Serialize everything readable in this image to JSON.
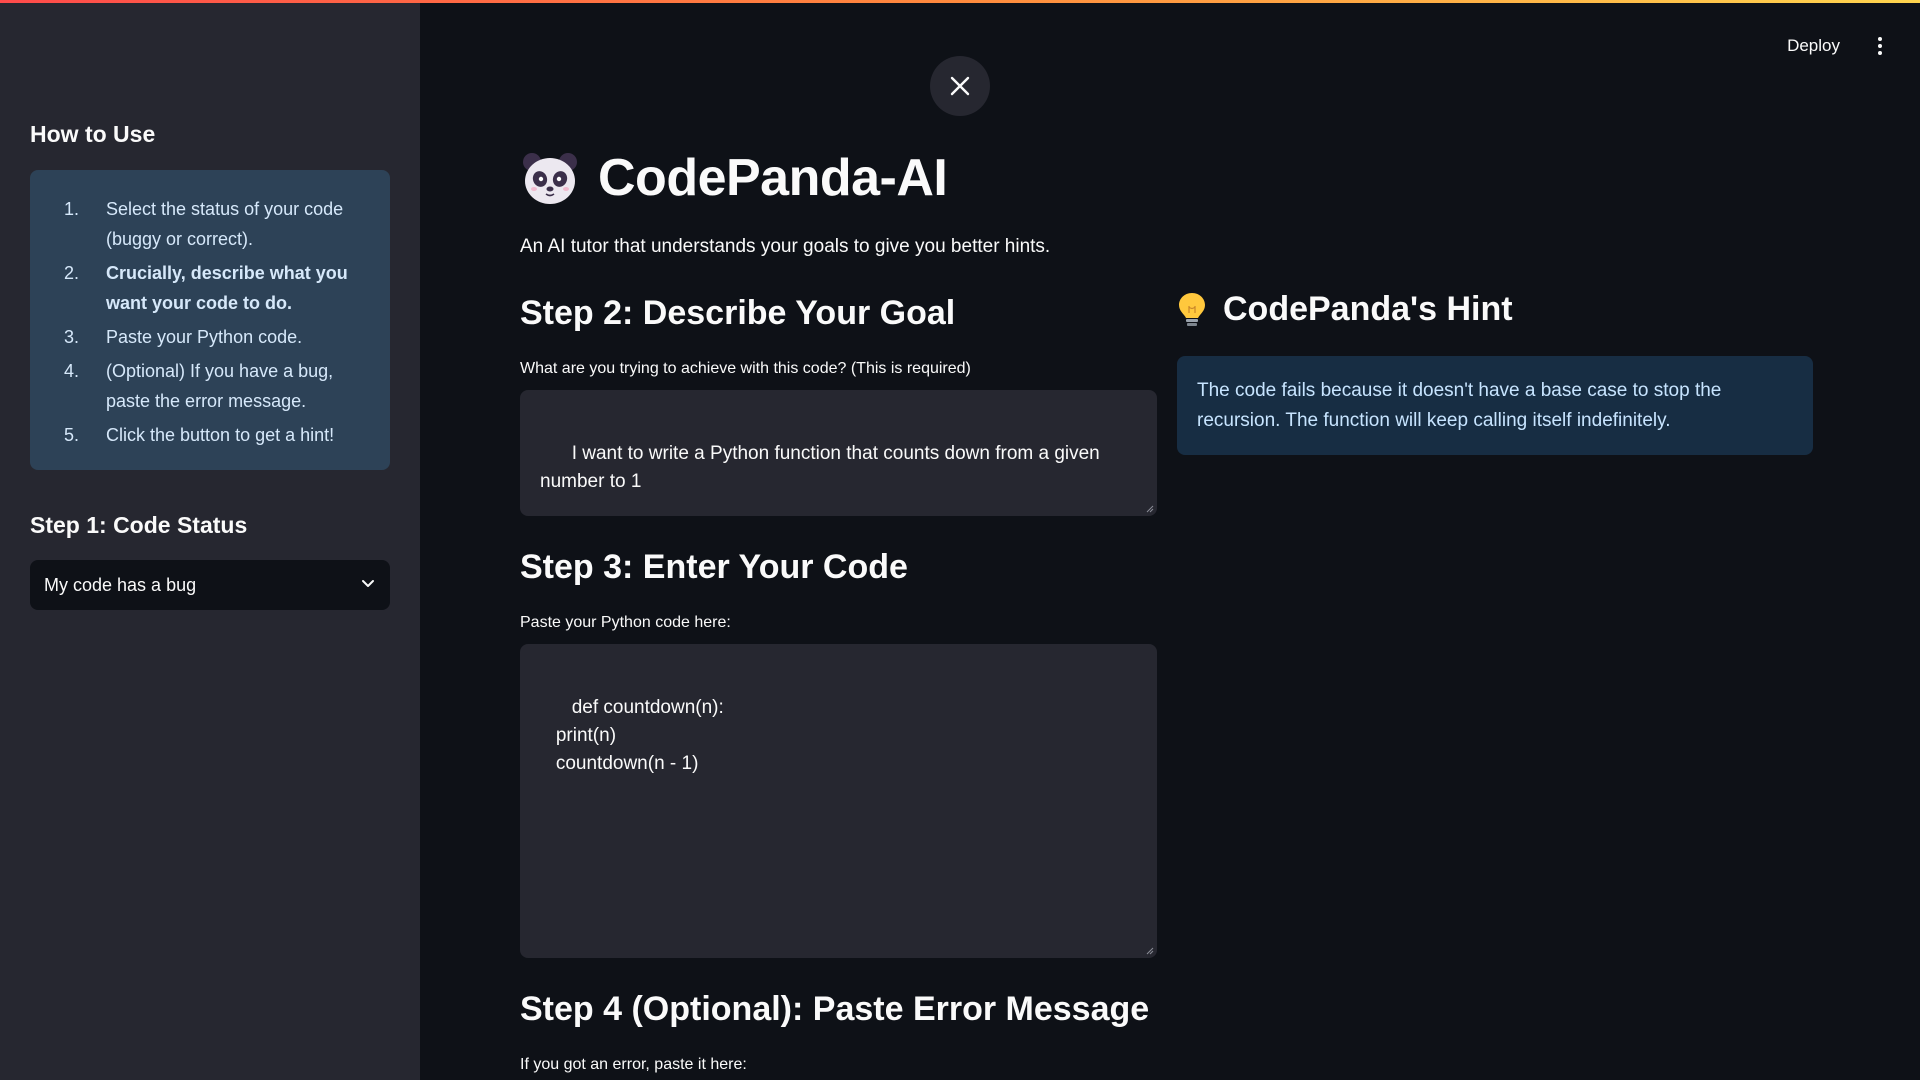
{
  "sidebar": {
    "how_to_title": "How to Use",
    "steps": [
      {
        "num": "1.",
        "text": "Select the status of your code (buggy or correct)."
      },
      {
        "num": "2.",
        "text": "Crucially, describe what you want your code to do."
      },
      {
        "num": "3.",
        "text": "Paste your Python code."
      },
      {
        "num": "4.",
        "text": "(Optional) If you have a bug, paste the error message."
      },
      {
        "num": "5.",
        "text": "Click the button to get a hint!"
      }
    ],
    "status_title": "Step 1: Code Status",
    "status_select": {
      "value": "My code has a bug",
      "icon": "chevron-down-icon"
    }
  },
  "header": {
    "deploy_label": "Deploy",
    "menu_icon": "kebab-menu-icon",
    "close_icon": "close-icon"
  },
  "main": {
    "title": "CodePanda-AI",
    "title_icon": "panda-icon",
    "subtitle": "An AI tutor that understands your goals to give you better hints.",
    "step2": {
      "heading": "Step 2: Describe Your Goal",
      "label": "What are you trying to achieve with this code? (This is required)",
      "value": "I want to write a Python function that counts down from a given number to 1"
    },
    "step3": {
      "heading": "Step 3: Enter Your Code",
      "label": "Paste your Python code here:",
      "value": "def countdown(n):\n   print(n)\n   countdown(n - 1)"
    },
    "step4": {
      "heading": "Step 4 (Optional): Paste Error Message",
      "label": "If you got an error, paste it here:"
    }
  },
  "hint": {
    "heading": "CodePanda's Hint",
    "icon": "lightbulb-icon",
    "text": "The code fails because it doesn't have a base case to stop the recursion. The function will keep calling itself indefinitely."
  },
  "colors": {
    "background": "#0e1117",
    "sidebar": "#262730",
    "info_box": "#2d4257",
    "hint_box": "#172d43",
    "accent_red": "#ff4b4b"
  }
}
